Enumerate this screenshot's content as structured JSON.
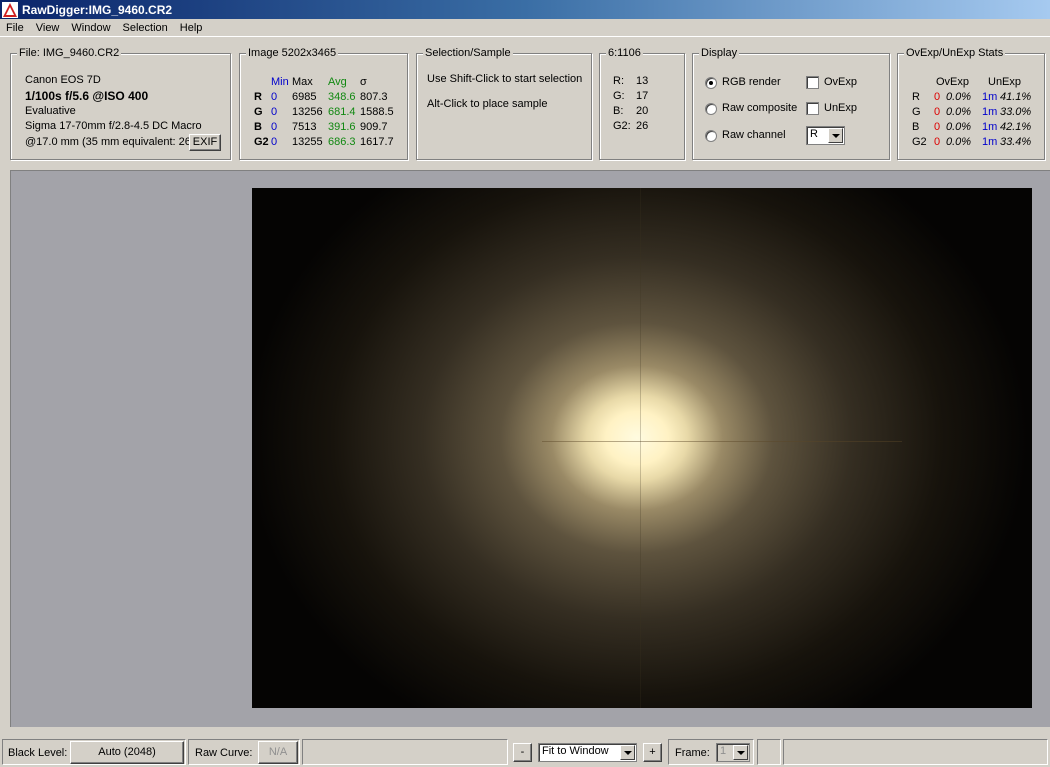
{
  "window": {
    "title": "RawDigger:IMG_9460.CR2"
  },
  "menu": [
    "File",
    "View",
    "Window",
    "Selection",
    "Help"
  ],
  "file_group": {
    "title": "File: IMG_9460.CR2",
    "camera": "Canon EOS 7D",
    "exposure": "1/100s f/5.6 @ISO 400",
    "metering": "Evaluative",
    "lens": "Sigma 17-70mm f/2.8-4.5 DC Macro",
    "focal": "@17.0 mm (35 mm equivalent: 26.",
    "exif_button": "EXIF"
  },
  "image_group": {
    "title": "Image 5202x3465",
    "headers": {
      "min": "Min",
      "max": "Max",
      "avg": "Avg",
      "sigma": "σ"
    },
    "rows": [
      {
        "ch": "R",
        "min": "0",
        "max": "6985",
        "avg": "348.6",
        "sigma": "807.3"
      },
      {
        "ch": "G",
        "min": "0",
        "max": "13256",
        "avg": "681.4",
        "sigma": "1588.5"
      },
      {
        "ch": "B",
        "min": "0",
        "max": "7513",
        "avg": "391.6",
        "sigma": "909.7"
      },
      {
        "ch": "G2",
        "min": "0",
        "max": "13255",
        "avg": "686.3",
        "sigma": "1617.7"
      }
    ]
  },
  "selection_group": {
    "title": "Selection/Sample",
    "hint1": "Use Shift-Click to start selection",
    "hint2": "Alt-Click to place sample"
  },
  "sample_group": {
    "title": "6:1106",
    "rows": [
      {
        "ch": "R:",
        "val": "13"
      },
      {
        "ch": "G:",
        "val": "17"
      },
      {
        "ch": "B:",
        "val": "20"
      },
      {
        "ch": "G2:",
        "val": "26"
      }
    ]
  },
  "display_group": {
    "title": "Display",
    "rgb_render": "RGB render",
    "raw_composite": "Raw composite",
    "raw_channel": "Raw channel",
    "ovexp": "OvExp",
    "unexp": "UnExp",
    "channel_select": "R",
    "selected_mode": "RGB render"
  },
  "stats_group": {
    "title": "OvExp/UnExp Stats",
    "headers": {
      "ovexp": "OvExp",
      "unexp": "UnExp"
    },
    "rows": [
      {
        "ch": "R",
        "ov_count": "0",
        "ov_pct": "0.0%",
        "un_count": "1m",
        "un_pct": "41.1%"
      },
      {
        "ch": "G",
        "ov_count": "0",
        "ov_pct": "0.0%",
        "un_count": "1m",
        "un_pct": "33.0%"
      },
      {
        "ch": "B",
        "ov_count": "0",
        "ov_pct": "0.0%",
        "un_count": "1m",
        "un_pct": "42.1%"
      },
      {
        "ch": "G2",
        "ov_count": "0",
        "ov_pct": "0.0%",
        "un_count": "1m",
        "un_pct": "33.4%"
      }
    ]
  },
  "statusbar": {
    "black_level_label": "Black Level:",
    "black_level_button": "Auto (2048)",
    "raw_curve_label": "Raw Curve:",
    "raw_curve_button": "N/A",
    "zoom_minus": "-",
    "zoom_select": "Fit to Window",
    "zoom_plus": "+",
    "frame_label": "Frame:",
    "frame_select": "1"
  },
  "colors": {
    "min_label": "#0000cc",
    "avg_label": "#118811",
    "overexp": "#dd0000",
    "unexp": "#0000cc"
  }
}
